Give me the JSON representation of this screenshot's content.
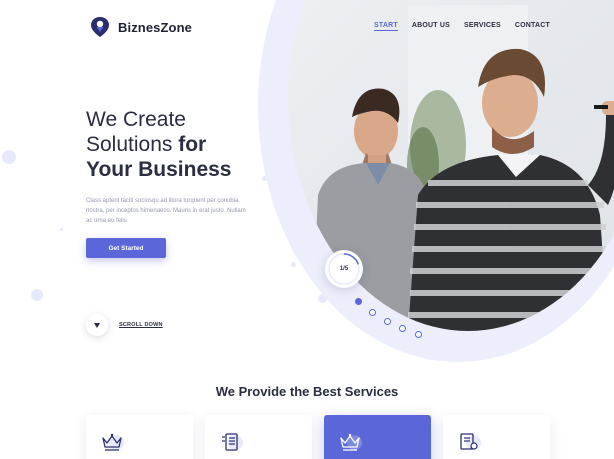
{
  "header": {
    "logo_text": "BiznesZone",
    "nav": [
      {
        "label": "START",
        "active": true
      },
      {
        "label": "ABOUT US",
        "active": false
      },
      {
        "label": "SERVICES",
        "active": false
      },
      {
        "label": "CONTACT",
        "active": false
      }
    ]
  },
  "hero": {
    "title_line1": "We Create",
    "title_line2_regular": "Solutions ",
    "title_line2_bold": "for",
    "title_line3": "Your Business",
    "description": "Class aptent taciti sociosqu ad litora torquent per conubia nostra, per inceptos himenaeos. Mauris in erat justo. Nullam ac urna eu felis",
    "cta_label": "Get Started",
    "scroll_label": "SCROLL DOWN",
    "slide_counter": "1/5"
  },
  "services": {
    "title_regular": "We Provide the ",
    "title_bold": "Best Services",
    "cards": [
      {
        "icon": "crown-icon",
        "active": false
      },
      {
        "icon": "document-icon",
        "active": false
      },
      {
        "icon": "crown-icon",
        "active": true
      },
      {
        "icon": "certificate-icon",
        "active": false
      }
    ]
  },
  "colors": {
    "accent": "#5b67d8",
    "text": "#2b2d42",
    "muted": "#9498ad",
    "ring": "#eceefc"
  }
}
